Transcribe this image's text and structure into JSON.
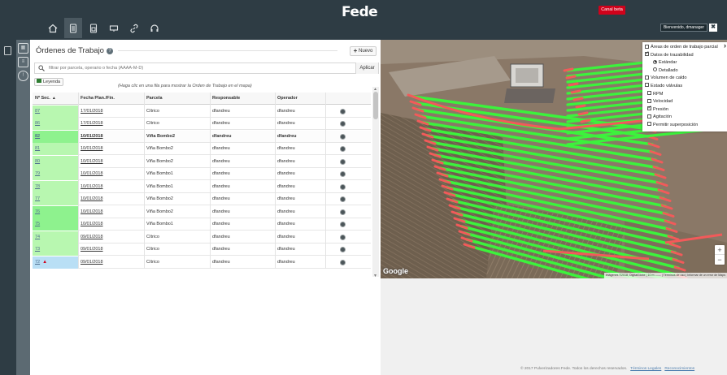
{
  "app": {
    "logo": "Fede",
    "beta_label": "Canal beta",
    "welcome": "Bienvenido, dmanager",
    "close_glyph": "✖"
  },
  "nav": [
    {
      "icon": "home-icon",
      "active": false
    },
    {
      "icon": "document-icon",
      "active": true
    },
    {
      "icon": "report-icon",
      "active": false
    },
    {
      "icon": "monitor-icon",
      "active": false
    },
    {
      "icon": "link-icon",
      "active": false
    },
    {
      "icon": "headset-icon",
      "active": false
    }
  ],
  "panel": {
    "title": "Órdenes de Trabajo",
    "new_label": "Nuevo",
    "search_placeholder": "filtrar por parcela, operario o fecha (AAAA-M-D)",
    "apply_label": "Aplicar",
    "legend_label": "Leyenda",
    "hint": "(Haga clic en una fila para mostrar la Orden de Trabajo en el mapa)"
  },
  "table": {
    "headers": [
      "Nº Sec.",
      "Fecha Plan./Fin.",
      "Parcela",
      "Responsable",
      "Operador",
      ""
    ],
    "sort_glyph": "▲",
    "rows": [
      {
        "seq": "87",
        "date": "17/01/2018",
        "parcel": "Cítrico",
        "resp": "dfandreu",
        "oper": "dfandreu",
        "highlight": "green-lt",
        "selected": false
      },
      {
        "seq": "86",
        "date": "17/01/2018",
        "parcel": "Cítrico",
        "resp": "dfandreu",
        "oper": "dfandreu",
        "highlight": "green-lt",
        "selected": false
      },
      {
        "seq": "82",
        "date": "10/01/2018",
        "parcel": "Viña Bombo2",
        "resp": "dfandreu",
        "oper": "dfandreu",
        "highlight": "green",
        "selected": true
      },
      {
        "seq": "81",
        "date": "10/01/2018",
        "parcel": "Viña Bombo2",
        "resp": "dfandreu",
        "oper": "dfandreu",
        "highlight": "green-lt",
        "selected": false
      },
      {
        "seq": "80",
        "date": "10/01/2018",
        "parcel": "Viña Bombo2",
        "resp": "dfandreu",
        "oper": "dfandreu",
        "highlight": "green-lt",
        "selected": false
      },
      {
        "seq": "79",
        "date": "10/01/2018",
        "parcel": "Viña Bombo1",
        "resp": "dfandreu",
        "oper": "dfandreu",
        "highlight": "green-lt",
        "selected": false
      },
      {
        "seq": "78",
        "date": "10/01/2018",
        "parcel": "Viña Bombo1",
        "resp": "dfandreu",
        "oper": "dfandreu",
        "highlight": "green-lt",
        "selected": false
      },
      {
        "seq": "77",
        "date": "10/01/2018",
        "parcel": "Viña Bombo2",
        "resp": "dfandreu",
        "oper": "dfandreu",
        "highlight": "green-lt",
        "selected": false
      },
      {
        "seq": "76",
        "date": "10/01/2018",
        "parcel": "Viña Bombo2",
        "resp": "dfandreu",
        "oper": "dfandreu",
        "highlight": "green",
        "selected": false
      },
      {
        "seq": "75",
        "date": "10/01/2018",
        "parcel": "Viña Bombo1",
        "resp": "dfandreu",
        "oper": "dfandreu",
        "highlight": "green",
        "selected": false
      },
      {
        "seq": "74",
        "date": "09/01/2018",
        "parcel": "Cítrico",
        "resp": "dfandreu",
        "oper": "dfandreu",
        "highlight": "green-lt",
        "selected": false
      },
      {
        "seq": "73",
        "date": "09/01/2018",
        "parcel": "Cítrico",
        "resp": "dfandreu",
        "oper": "dfandreu",
        "highlight": "green-lt",
        "selected": false
      },
      {
        "seq": "72",
        "date": "09/01/2018",
        "parcel": "Cítrico",
        "resp": "dfandreu",
        "oper": "dfandreu",
        "highlight": "blue",
        "selected": false,
        "warning": true
      }
    ]
  },
  "map": {
    "provider": "Google",
    "attribution": "Imágenes ©2018, DigitalGlobe | 10 m ⎯⎯⎯⎯ | Términos de uso | Informar de un error de Maps",
    "zoom_in": "+",
    "zoom_out": "−",
    "layers_close": "›",
    "layers": [
      {
        "label": "Áreas de orden de trabajo parcial",
        "type": "checkbox",
        "checked": false,
        "indent": 0
      },
      {
        "label": "Datos de trazabilidad",
        "type": "checkbox",
        "checked": true,
        "indent": 0
      },
      {
        "label": "Estándar",
        "type": "radio",
        "checked": true,
        "indent": 2
      },
      {
        "label": "Detallado",
        "type": "radio",
        "checked": false,
        "indent": 2
      },
      {
        "label": "Volumen de caldo",
        "type": "checkbox",
        "checked": false,
        "indent": 0
      },
      {
        "label": "Estado válvulas",
        "type": "checkbox",
        "checked": false,
        "indent": 0
      },
      {
        "label": "RPM",
        "type": "checkbox",
        "checked": false,
        "indent": 3
      },
      {
        "label": "Velocidad",
        "type": "checkbox",
        "checked": false,
        "indent": 3
      },
      {
        "label": "Presión",
        "type": "checkbox",
        "checked": true,
        "indent": 3
      },
      {
        "label": "Agitación",
        "type": "checkbox",
        "checked": false,
        "indent": 3
      },
      {
        "label": "Permitir superposición",
        "type": "checkbox",
        "checked": false,
        "indent": 3
      }
    ]
  },
  "footer": {
    "copyright": "© 2017 Pulverizadores Fede. Todos los derechos reservados.",
    "legal": "Términos Legales",
    "credits": "Reconocimientos"
  },
  "colors": {
    "topbar": "#2e3c44",
    "beta": "#d0021b",
    "track_ok": "#3cf23c",
    "track_alert": "#f25a5a",
    "row_green": "#8ef28e",
    "row_green_light": "#b8f7b0",
    "row_blue": "#b9dff5"
  }
}
